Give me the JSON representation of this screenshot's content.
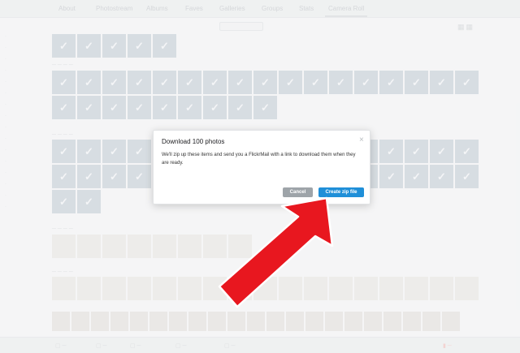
{
  "nav": {
    "tabs": [
      "About",
      "Photostream",
      "Albums",
      "Faves",
      "Galleries",
      "Groups",
      "Stats",
      "Camera Roll"
    ],
    "active_tab": "Camera Roll"
  },
  "modal": {
    "title": "Download 100 photos",
    "body": "We'll zip up these items and send you a FlickrMail with a link to download them when they are ready.",
    "cancel_label": "Cancel",
    "create_label": "Create zip file",
    "close_glyph": "×"
  },
  "colors": {
    "primary_button": "#1f8fd8",
    "cancel_button": "#9ea4a9",
    "arrow": "#e8171f"
  },
  "icons": {
    "close": "close-icon",
    "checkmark": "checkmark-icon",
    "arrow": "red-arrow-annotation"
  }
}
